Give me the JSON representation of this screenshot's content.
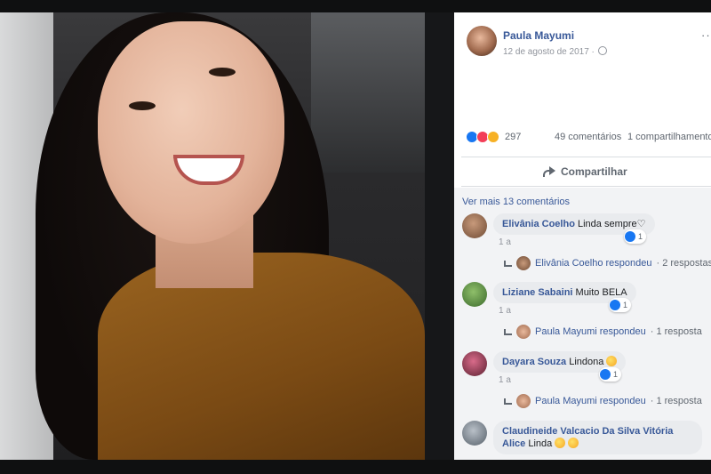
{
  "post": {
    "author": "Paula Mayumi",
    "date": "12 de agosto de 2017 ·",
    "more_label": "···"
  },
  "stats": {
    "reactions": "297",
    "comments": "49 comentários",
    "shares": "1 compartilhamento"
  },
  "actions": {
    "share_label": "Compartilhar"
  },
  "comments_section": {
    "view_more": "Ver mais 13 comentários",
    "comments": [
      {
        "name": "Elivânia Coelho",
        "text": "Linda sempre♡",
        "likes": "1",
        "time": "1 a",
        "reply_author": "Elivânia Coelho respondeu",
        "reply_count": "· 2 respostas"
      },
      {
        "name": "Liziane Sabaini",
        "text": "Muito BELA",
        "likes": "1",
        "time": "1 a",
        "reply_author": "Paula Mayumi respondeu",
        "reply_count": "· 1 resposta"
      },
      {
        "name": "Dayara Souza",
        "text": "Lindona",
        "likes": "1",
        "time": "1 a",
        "reply_author": "Paula Mayumi respondeu",
        "reply_count": "· 1 resposta"
      },
      {
        "name": "Claudineide Valcacio Da Silva Vitória",
        "name_line2": "Alice",
        "text": "Linda"
      }
    ]
  },
  "colors": {
    "link_blue": "#385898",
    "like_blue": "#1877f2",
    "love_red": "#f33e58",
    "wow_yellow": "#f7b125",
    "comment_bg": "#e9ebee"
  }
}
